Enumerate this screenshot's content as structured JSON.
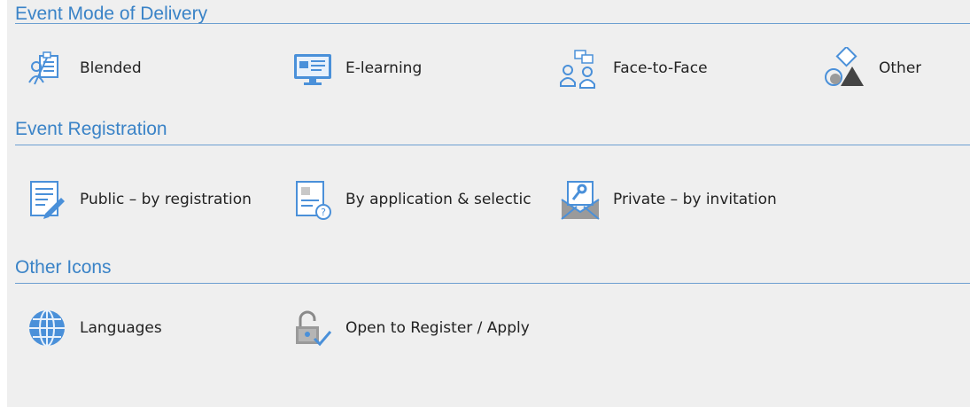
{
  "sections": [
    {
      "title": "Event Mode of Delivery",
      "items": [
        {
          "label": "Blended",
          "icon": "blended-icon"
        },
        {
          "label": "E-learning",
          "icon": "elearning-icon"
        },
        {
          "label": "Face-to-Face",
          "icon": "face-to-face-icon"
        },
        {
          "label": "Other",
          "icon": "other-shapes-icon"
        }
      ]
    },
    {
      "title": "Event Registration",
      "items": [
        {
          "label": "Public – by registration",
          "icon": "public-registration-icon"
        },
        {
          "label": "By application & selectic",
          "icon": "application-selection-icon"
        },
        {
          "label": "Private – by invitation",
          "icon": "private-invitation-icon"
        }
      ]
    },
    {
      "title": "Other Icons",
      "items": [
        {
          "label": "Languages",
          "icon": "globe-icon"
        },
        {
          "label": "Open to Register / Apply",
          "icon": "open-lock-icon"
        }
      ]
    }
  ],
  "colors": {
    "accent": "#3a83c7",
    "icon_blue": "#4a90d9",
    "icon_gray": "#8a8a8a",
    "background": "#efefef"
  }
}
